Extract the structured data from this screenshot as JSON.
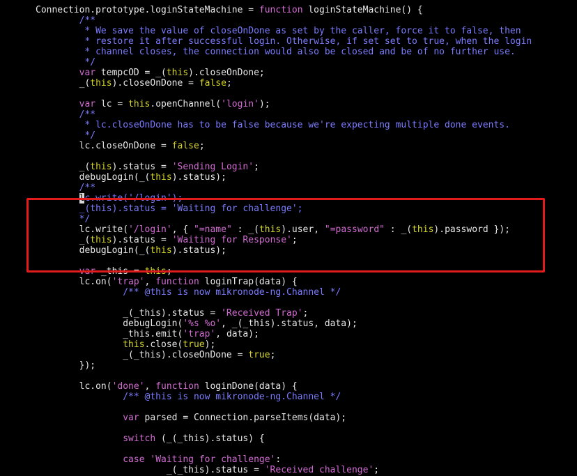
{
  "editor": {
    "colors": {
      "background": "#000000",
      "plain": "#e8e8e8",
      "keyword": "#d16bd1",
      "string": "#d16bd1",
      "comment": "#7b7bff",
      "boolean": "#d4d42c",
      "this": "#d4d42c",
      "highlight_box": "#e21c1c"
    },
    "lines": [
      [
        [
          "k",
          ""
        ]
      ],
      [
        [
          "p",
          "Connection.prototype.loginStateMachine = "
        ],
        [
          "k",
          "function"
        ],
        [
          "p",
          " loginStateMachine() {"
        ]
      ],
      [
        [
          "c",
          "        /**"
        ]
      ],
      [
        [
          "c",
          "         * We save the value of closeOnDone as set by the caller, force it to false, then"
        ]
      ],
      [
        [
          "c",
          "         * restore it after successful login. Otherwise, if set set to true, when the login"
        ]
      ],
      [
        [
          "c",
          "         * channel closes, the connection would also be closed and be of no further use."
        ]
      ],
      [
        [
          "c",
          "         */"
        ]
      ],
      [
        [
          "p",
          "        "
        ],
        [
          "k",
          "var"
        ],
        [
          "p",
          " tempcOD = _("
        ],
        [
          "th",
          "this"
        ],
        [
          "p",
          ").closeOnDone;"
        ]
      ],
      [
        [
          "p",
          "        _("
        ],
        [
          "th",
          "this"
        ],
        [
          "p",
          ").closeOnDone = "
        ],
        [
          "b",
          "false"
        ],
        [
          "p",
          ";"
        ]
      ],
      [
        [
          "p",
          ""
        ]
      ],
      [
        [
          "p",
          "        "
        ],
        [
          "k",
          "var"
        ],
        [
          "p",
          " lc = "
        ],
        [
          "th",
          "this"
        ],
        [
          "p",
          ".openChannel("
        ],
        [
          "s",
          "'login'"
        ],
        [
          "p",
          ");"
        ]
      ],
      [
        [
          "c",
          "        /**"
        ]
      ],
      [
        [
          "c",
          "         * lc.closeOnDone has to be false because we're expecting multiple done events."
        ]
      ],
      [
        [
          "c",
          "         */"
        ]
      ],
      [
        [
          "p",
          "        lc.closeOnDone = "
        ],
        [
          "b",
          "false"
        ],
        [
          "p",
          ";"
        ]
      ],
      [
        [
          "p",
          ""
        ]
      ],
      [
        [
          "p",
          "        _("
        ],
        [
          "th",
          "this"
        ],
        [
          "p",
          ").status = "
        ],
        [
          "s",
          "'Sending Login'"
        ],
        [
          "p",
          ";"
        ]
      ],
      [
        [
          "p",
          "        debugLogin(_("
        ],
        [
          "th",
          "this"
        ],
        [
          "p",
          ").status);"
        ]
      ],
      [
        [
          "c",
          "        /**"
        ]
      ],
      [
        [
          "p",
          "        "
        ],
        [
          "cur",
          "l"
        ],
        [
          "c",
          "c.write('/login');"
        ]
      ],
      [
        [
          "c",
          "        _(this).status = 'Waiting for challenge';"
        ]
      ],
      [
        [
          "c",
          "        */"
        ]
      ],
      [
        [
          "p",
          "        lc.write("
        ],
        [
          "s",
          "'/login'"
        ],
        [
          "p",
          ", { "
        ],
        [
          "s",
          "\"=name\""
        ],
        [
          "p",
          " : _("
        ],
        [
          "th",
          "this"
        ],
        [
          "p",
          ").user, "
        ],
        [
          "s",
          "\"=password\""
        ],
        [
          "p",
          " : _("
        ],
        [
          "th",
          "this"
        ],
        [
          "p",
          ").password });"
        ]
      ],
      [
        [
          "p",
          "        _("
        ],
        [
          "th",
          "this"
        ],
        [
          "p",
          ").status = "
        ],
        [
          "s",
          "'Waiting for Response'"
        ],
        [
          "p",
          ";"
        ]
      ],
      [
        [
          "p",
          "        debugLogin(_("
        ],
        [
          "th",
          "this"
        ],
        [
          "p",
          ").status);"
        ]
      ],
      [
        [
          "p",
          ""
        ]
      ],
      [
        [
          "p",
          "        "
        ],
        [
          "k",
          "var"
        ],
        [
          "p",
          " _this = "
        ],
        [
          "th",
          "this"
        ],
        [
          "p",
          ";"
        ]
      ],
      [
        [
          "p",
          "        lc.on("
        ],
        [
          "s",
          "'trap'"
        ],
        [
          "p",
          ", "
        ],
        [
          "k",
          "function"
        ],
        [
          "p",
          " loginTrap(data) {"
        ]
      ],
      [
        [
          "c",
          "                /** @this is now mikronode-ng.Channel */"
        ]
      ],
      [
        [
          "p",
          ""
        ]
      ],
      [
        [
          "p",
          "                _(_this).status = "
        ],
        [
          "s",
          "'Received Trap'"
        ],
        [
          "p",
          ";"
        ]
      ],
      [
        [
          "p",
          "                debugLogin("
        ],
        [
          "s",
          "'%s %o'"
        ],
        [
          "p",
          ", _(_this).status, data);"
        ]
      ],
      [
        [
          "p",
          "                _this.emit("
        ],
        [
          "s",
          "'trap'"
        ],
        [
          "p",
          ", data);"
        ]
      ],
      [
        [
          "p",
          "                "
        ],
        [
          "th",
          "this"
        ],
        [
          "p",
          ".close("
        ],
        [
          "b",
          "true"
        ],
        [
          "p",
          ");"
        ]
      ],
      [
        [
          "p",
          "                _(_this).closeOnDone = "
        ],
        [
          "b",
          "true"
        ],
        [
          "p",
          ";"
        ]
      ],
      [
        [
          "p",
          "        });"
        ]
      ],
      [
        [
          "p",
          ""
        ]
      ],
      [
        [
          "p",
          "        lc.on("
        ],
        [
          "s",
          "'done'"
        ],
        [
          "p",
          ", "
        ],
        [
          "k",
          "function"
        ],
        [
          "p",
          " loginDone(data) {"
        ]
      ],
      [
        [
          "c",
          "                /** @this is now mikronode-ng.Channel */"
        ]
      ],
      [
        [
          "p",
          ""
        ]
      ],
      [
        [
          "p",
          "                "
        ],
        [
          "k",
          "var"
        ],
        [
          "p",
          " parsed = Connection.parseItems(data);"
        ]
      ],
      [
        [
          "p",
          ""
        ]
      ],
      [
        [
          "p",
          "                "
        ],
        [
          "k",
          "switch"
        ],
        [
          "p",
          " (_(_this).status) {"
        ]
      ],
      [
        [
          "p",
          ""
        ]
      ],
      [
        [
          "p",
          "                "
        ],
        [
          "k",
          "case"
        ],
        [
          "p",
          " "
        ],
        [
          "s",
          "'Waiting for challenge'"
        ],
        [
          "p",
          ":"
        ]
      ],
      [
        [
          "p",
          "                        _(_this).status = "
        ],
        [
          "s",
          "'Received challenge'"
        ],
        [
          "p",
          ";"
        ]
      ]
    ]
  }
}
